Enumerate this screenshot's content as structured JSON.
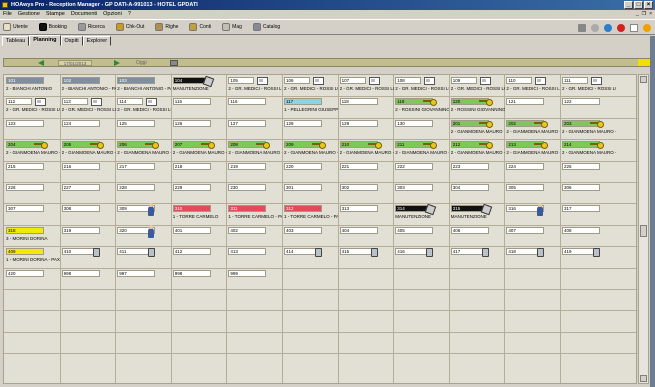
{
  "app": {
    "title": "HOAwys Pro - Reception Manager - GP DATI-A-991013 - HOTEL GPDATI"
  },
  "menu": [
    "File",
    "Gestione",
    "Stampe",
    "Documenti",
    "Opzioni",
    "?"
  ],
  "toolbar": [
    {
      "label": "Utente",
      "icon": "user-icon"
    },
    {
      "label": "Booking",
      "icon": "booking-icon"
    },
    {
      "label": "Ricerca",
      "icon": "search-icon"
    },
    {
      "label": "Chk-Out",
      "icon": "checkout-icon"
    },
    {
      "label": "Righe",
      "icon": "rows-icon"
    },
    {
      "label": "Conti",
      "icon": "accounts-icon"
    },
    {
      "label": "Mag",
      "icon": "warehouse-icon"
    },
    {
      "label": "Catalog",
      "icon": "catalog-icon"
    }
  ],
  "tabs": [
    "Tableau",
    "Planning",
    "Ospiti",
    "Explorer"
  ],
  "datebar": {
    "date": "17/01/2013",
    "today_label": "Oggi"
  },
  "colors": {
    "free": "#fefefe",
    "occupied": "#7ec85a",
    "departure": "#7e8fa2",
    "maintenance": "#111111",
    "arrival": "#8ad4e6",
    "yellow": "#f2ea00",
    "red": "#e54a5a"
  },
  "rooms": [
    {
      "r": 0,
      "c": 0,
      "num": "101",
      "status": "gray",
      "guest": "2 - BIANCHI ANTONIO"
    },
    {
      "r": 0,
      "c": 1,
      "num": "102",
      "status": "gray",
      "guest": "2 - BIANCHI ANTONIO - PAX 2"
    },
    {
      "r": 0,
      "c": 2,
      "num": "103",
      "status": "gray",
      "guest": "2 - BIANCHI ANTONIO - PAX 3"
    },
    {
      "r": 0,
      "c": 3,
      "num": "104",
      "status": "black",
      "guest": "MANUTENZIONE",
      "icon": "tools"
    },
    {
      "r": 0,
      "c": 4,
      "num": "105",
      "status": "tw",
      "guest": "2 - GR. MEDICI - ROSSI LUCA",
      "icon": "bed"
    },
    {
      "r": 0,
      "c": 5,
      "num": "106",
      "status": "tw",
      "guest": "2 - GR. MEDICI - ROSSI LUCA - PAX 2",
      "icon": "bed"
    },
    {
      "r": 0,
      "c": 6,
      "num": "107",
      "status": "tw",
      "guest": "2 - GR. MEDICI - ROSSI LUCA - PAX 3",
      "icon": "bed"
    },
    {
      "r": 0,
      "c": 7,
      "num": "108",
      "status": "tw",
      "guest": "2 - GR. MEDICI - ROSSI LUCA - PAX 4",
      "icon": "bed"
    },
    {
      "r": 0,
      "c": 8,
      "num": "109",
      "status": "tw",
      "guest": "2 - GR. MEDICI - ROSSI LUCA - PAX 5",
      "icon": "bed"
    },
    {
      "r": 0,
      "c": 9,
      "num": "110",
      "status": "tw",
      "guest": "2 - GR. MEDICI - ROSSI LUCA - PAX 6",
      "icon": "bed"
    },
    {
      "r": 0,
      "c": 10,
      "num": "111",
      "status": "tw",
      "guest": "2 - GR. MEDICI - ROSSI LUCA - PAX 7",
      "icon": "bed"
    },
    {
      "r": 1,
      "c": 0,
      "num": "112",
      "status": "tw",
      "guest": "2 - GR. MEDICI - ROSSI LUCA - PAX 8",
      "icon": "bed"
    },
    {
      "r": 1,
      "c": 1,
      "num": "113",
      "status": "tw",
      "guest": "2 - GR. MEDICI - ROSSI LUCA - PAX 9",
      "icon": "bed"
    },
    {
      "r": 1,
      "c": 2,
      "num": "114",
      "status": "tw",
      "guest": "2 - GR. MEDICI - ROSSI LUCA - PAX 10",
      "icon": "bed"
    },
    {
      "r": 1,
      "c": 3,
      "num": "115",
      "status": "free",
      "guest": ""
    },
    {
      "r": 1,
      "c": 4,
      "num": "116",
      "status": "free",
      "guest": ""
    },
    {
      "r": 1,
      "c": 5,
      "num": "117",
      "status": "cyan",
      "guest": "1 - PELLEGRINI GIUSEPPE"
    },
    {
      "r": 1,
      "c": 6,
      "num": "118",
      "status": "free",
      "guest": ""
    },
    {
      "r": 1,
      "c": 7,
      "num": "119",
      "status": "green",
      "guest": "2 - ROSSINI GIOVANNINO",
      "icon": "key"
    },
    {
      "r": 1,
      "c": 8,
      "num": "120",
      "status": "green",
      "guest": "2 - ROSSINI GIOVANNINO - PAX 2",
      "icon": "key"
    },
    {
      "r": 1,
      "c": 9,
      "num": "121",
      "status": "free",
      "guest": ""
    },
    {
      "r": 1,
      "c": 10,
      "num": "122",
      "status": "free",
      "guest": ""
    },
    {
      "r": 2,
      "c": 0,
      "num": "123",
      "status": "free",
      "guest": ""
    },
    {
      "r": 2,
      "c": 1,
      "num": "124",
      "status": "free",
      "guest": ""
    },
    {
      "r": 2,
      "c": 2,
      "num": "125",
      "status": "free",
      "guest": ""
    },
    {
      "r": 2,
      "c": 3,
      "num": "126",
      "status": "free",
      "guest": ""
    },
    {
      "r": 2,
      "c": 4,
      "num": "127",
      "status": "free",
      "guest": ""
    },
    {
      "r": 2,
      "c": 5,
      "num": "128",
      "status": "free",
      "guest": ""
    },
    {
      "r": 2,
      "c": 6,
      "num": "129",
      "status": "free",
      "guest": ""
    },
    {
      "r": 2,
      "c": 7,
      "num": "130",
      "status": "free",
      "guest": ""
    },
    {
      "r": 2,
      "c": 8,
      "num": "201",
      "status": "green",
      "guest": "2 - GIANMOENA MAURO",
      "icon": "key"
    },
    {
      "r": 2,
      "c": 9,
      "num": "202",
      "status": "green",
      "guest": "2 - GIANMOENA MAURO - PAX 2",
      "icon": "key"
    },
    {
      "r": 2,
      "c": 10,
      "num": "203",
      "status": "green",
      "guest": "2 - GIANMOENA MAURO - PAX 3",
      "icon": "key"
    },
    {
      "r": 3,
      "c": 0,
      "num": "204",
      "status": "green",
      "guest": "2 - GIANMOENA MAURO - PAX 4",
      "icon": "key"
    },
    {
      "r": 3,
      "c": 1,
      "num": "205",
      "status": "green",
      "guest": "2 - GIANMOENA MAURO - PAX 5",
      "icon": "key"
    },
    {
      "r": 3,
      "c": 2,
      "num": "206",
      "status": "green",
      "guest": "2 - GIANMOENA MAURO - PAX 6",
      "icon": "key"
    },
    {
      "r": 3,
      "c": 3,
      "num": "207",
      "status": "green",
      "guest": "2 - GIANMOENA MAURO - PAX 7",
      "icon": "key"
    },
    {
      "r": 3,
      "c": 4,
      "num": "208",
      "status": "green",
      "guest": "2 - GIANMOENA MAURO - PAX 8",
      "icon": "key"
    },
    {
      "r": 3,
      "c": 5,
      "num": "209",
      "status": "green",
      "guest": "2 - GIANMOENA MAURO - PAX 9",
      "icon": "key"
    },
    {
      "r": 3,
      "c": 6,
      "num": "210",
      "status": "green",
      "guest": "2 - GIANMOENA MAURO - PAX 10",
      "icon": "key"
    },
    {
      "r": 3,
      "c": 7,
      "num": "211",
      "status": "green",
      "guest": "2 - GIANMOENA MAURO - PAX 11",
      "icon": "key"
    },
    {
      "r": 3,
      "c": 8,
      "num": "212",
      "status": "green",
      "guest": "2 - GIANMOENA MAURO - PAX 12",
      "icon": "key"
    },
    {
      "r": 3,
      "c": 9,
      "num": "213",
      "status": "green",
      "guest": "2 - GIANMOENA MAURO - PAX 13",
      "icon": "key"
    },
    {
      "r": 3,
      "c": 10,
      "num": "214",
      "status": "green",
      "guest": "2 - GIANMOENA MAURO - PAX 14",
      "icon": "key"
    },
    {
      "r": 4,
      "c": 0,
      "num": "215",
      "status": "free",
      "guest": ""
    },
    {
      "r": 4,
      "c": 1,
      "num": "216",
      "status": "free",
      "guest": ""
    },
    {
      "r": 4,
      "c": 2,
      "num": "217",
      "status": "free",
      "guest": ""
    },
    {
      "r": 4,
      "c": 3,
      "num": "218",
      "status": "free",
      "guest": ""
    },
    {
      "r": 4,
      "c": 4,
      "num": "219",
      "status": "free",
      "guest": ""
    },
    {
      "r": 4,
      "c": 5,
      "num": "220",
      "status": "free",
      "guest": ""
    },
    {
      "r": 4,
      "c": 6,
      "num": "221",
      "status": "free",
      "guest": ""
    },
    {
      "r": 4,
      "c": 7,
      "num": "222",
      "status": "free",
      "guest": ""
    },
    {
      "r": 4,
      "c": 8,
      "num": "223",
      "status": "free",
      "guest": ""
    },
    {
      "r": 4,
      "c": 9,
      "num": "224",
      "status": "free",
      "guest": ""
    },
    {
      "r": 4,
      "c": 10,
      "num": "225",
      "status": "free",
      "guest": ""
    },
    {
      "r": 5,
      "c": 0,
      "num": "226",
      "status": "free",
      "guest": ""
    },
    {
      "r": 5,
      "c": 1,
      "num": "227",
      "status": "free",
      "guest": ""
    },
    {
      "r": 5,
      "c": 2,
      "num": "228",
      "status": "free",
      "guest": ""
    },
    {
      "r": 5,
      "c": 3,
      "num": "229",
      "status": "free",
      "guest": ""
    },
    {
      "r": 5,
      "c": 4,
      "num": "230",
      "status": "free",
      "guest": ""
    },
    {
      "r": 5,
      "c": 5,
      "num": "301",
      "status": "free",
      "guest": ""
    },
    {
      "r": 5,
      "c": 6,
      "num": "302",
      "status": "free",
      "guest": ""
    },
    {
      "r": 5,
      "c": 7,
      "num": "303",
      "status": "free",
      "guest": ""
    },
    {
      "r": 5,
      "c": 8,
      "num": "304",
      "status": "free",
      "guest": ""
    },
    {
      "r": 5,
      "c": 9,
      "num": "305",
      "status": "free",
      "guest": ""
    },
    {
      "r": 5,
      "c": 10,
      "num": "306",
      "status": "free",
      "guest": ""
    },
    {
      "r": 6,
      "c": 0,
      "num": "307",
      "status": "free",
      "guest": ""
    },
    {
      "r": 6,
      "c": 1,
      "num": "308",
      "status": "free",
      "guest": ""
    },
    {
      "r": 6,
      "c": 2,
      "num": "309",
      "status": "free",
      "guest": "",
      "icon": "maid"
    },
    {
      "r": 6,
      "c": 3,
      "num": "310",
      "status": "red",
      "guest": "1 - TORRE CARMELO"
    },
    {
      "r": 6,
      "c": 4,
      "num": "311",
      "status": "red",
      "guest": "1 - TORRE CARMELO - PAX 2"
    },
    {
      "r": 6,
      "c": 5,
      "num": "312",
      "status": "red",
      "guest": "1 - TORRE CARMELO - PAX 3"
    },
    {
      "r": 6,
      "c": 6,
      "num": "313",
      "status": "free",
      "guest": ""
    },
    {
      "r": 6,
      "c": 7,
      "num": "314",
      "status": "black",
      "guest": "MANUTENZIONE",
      "icon": "tools"
    },
    {
      "r": 6,
      "c": 8,
      "num": "315",
      "status": "black",
      "guest": "MANUTENZIONE",
      "icon": "tools"
    },
    {
      "r": 6,
      "c": 9,
      "num": "316",
      "status": "free",
      "guest": "",
      "icon": "maid"
    },
    {
      "r": 6,
      "c": 10,
      "num": "317",
      "status": "free",
      "guest": ""
    },
    {
      "r": 7,
      "c": 0,
      "num": "318",
      "status": "yellow",
      "guest": "3 - MORINI DORINA"
    },
    {
      "r": 7,
      "c": 1,
      "num": "319",
      "status": "free",
      "guest": ""
    },
    {
      "r": 7,
      "c": 2,
      "num": "320",
      "status": "free",
      "guest": "",
      "icon": "maid"
    },
    {
      "r": 7,
      "c": 3,
      "num": "401",
      "status": "free",
      "guest": ""
    },
    {
      "r": 7,
      "c": 4,
      "num": "402",
      "status": "free",
      "guest": ""
    },
    {
      "r": 7,
      "c": 5,
      "num": "403",
      "status": "free",
      "guest": ""
    },
    {
      "r": 7,
      "c": 6,
      "num": "404",
      "status": "free",
      "guest": ""
    },
    {
      "r": 7,
      "c": 7,
      "num": "405",
      "status": "free",
      "guest": ""
    },
    {
      "r": 7,
      "c": 8,
      "num": "406",
      "status": "free",
      "guest": ""
    },
    {
      "r": 7,
      "c": 9,
      "num": "407",
      "status": "free",
      "guest": ""
    },
    {
      "r": 7,
      "c": 10,
      "num": "408",
      "status": "free",
      "guest": ""
    },
    {
      "r": 8,
      "c": 0,
      "num": "409",
      "status": "yellow",
      "guest": "1 - MORINI DORINA - PAX 2"
    },
    {
      "r": 8,
      "c": 1,
      "num": "410",
      "status": "free",
      "guest": "",
      "icon": "bin"
    },
    {
      "r": 8,
      "c": 2,
      "num": "411",
      "status": "free",
      "guest": "",
      "icon": "bin"
    },
    {
      "r": 8,
      "c": 3,
      "num": "412",
      "status": "free",
      "guest": ""
    },
    {
      "r": 8,
      "c": 4,
      "num": "413",
      "status": "free",
      "guest": ""
    },
    {
      "r": 8,
      "c": 5,
      "num": "414",
      "status": "free",
      "guest": "",
      "icon": "bin"
    },
    {
      "r": 8,
      "c": 6,
      "num": "415",
      "status": "free",
      "guest": "",
      "icon": "bin"
    },
    {
      "r": 8,
      "c": 7,
      "num": "416",
      "status": "free",
      "guest": "",
      "icon": "bin"
    },
    {
      "r": 8,
      "c": 8,
      "num": "417",
      "status": "free",
      "guest": "",
      "icon": "bin"
    },
    {
      "r": 8,
      "c": 9,
      "num": "418",
      "status": "free",
      "guest": "",
      "icon": "bin"
    },
    {
      "r": 8,
      "c": 10,
      "num": "419",
      "status": "free",
      "guest": "",
      "icon": "bin"
    },
    {
      "r": 9,
      "c": 0,
      "num": "420",
      "status": "free",
      "guest": ""
    },
    {
      "r": 9,
      "c": 1,
      "num": "998",
      "status": "free",
      "guest": ""
    },
    {
      "r": 9,
      "c": 2,
      "num": "997",
      "status": "free",
      "guest": ""
    },
    {
      "r": 9,
      "c": 3,
      "num": "998",
      "status": "free",
      "guest": ""
    },
    {
      "r": 9,
      "c": 4,
      "num": "999",
      "status": "free",
      "guest": ""
    }
  ]
}
